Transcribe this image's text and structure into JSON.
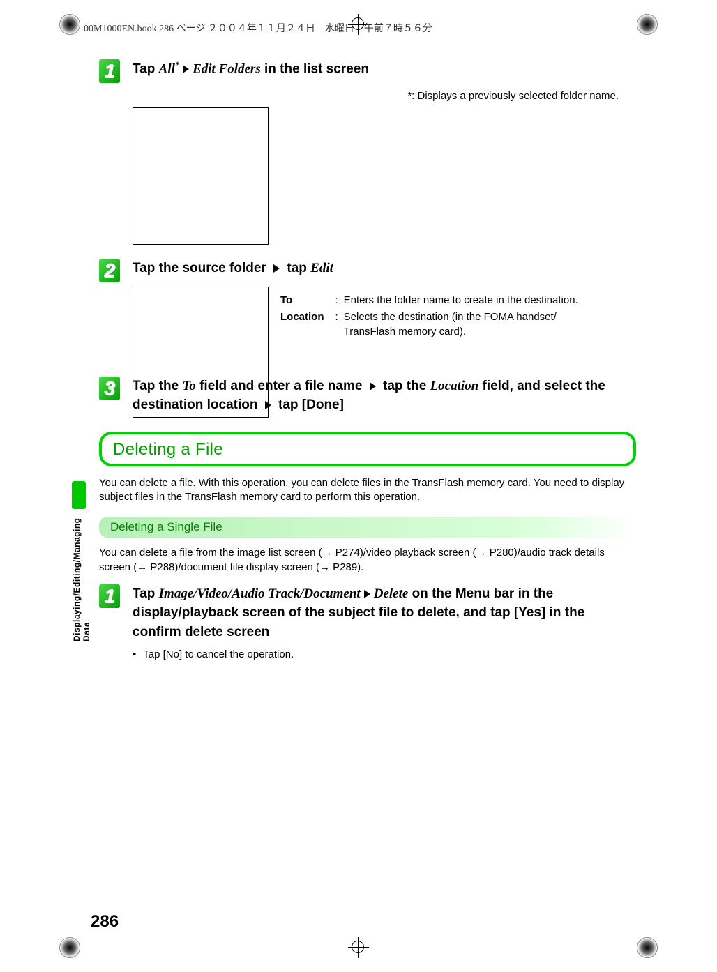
{
  "header": {
    "print_info": "00M1000EN.book  286 ページ  ２００４年１１月２４日　水曜日　午前７時５６分"
  },
  "side_tab": {
    "label": "Displaying/Editing/Managing Data"
  },
  "steps_a": [
    {
      "num": "1",
      "prefix": "Tap ",
      "ital1": "All",
      "sup": "*",
      "mid": " ",
      "ital2": "Edit Folders",
      "suffix": " in the list screen"
    },
    {
      "num": "2",
      "prefix": "Tap the source folder ",
      "ital1": "",
      "mid": " tap ",
      "ital2": "Edit",
      "suffix": ""
    },
    {
      "num": "3",
      "line": "Tap the {i}To{/i} field and enter a file name {t} tap the {i}Location{/i} field, and select the destination location {t} tap [Done]"
    }
  ],
  "footnote": "*: Displays a previously selected folder name.",
  "defs": {
    "to_label": "To",
    "to_desc": "Enters the folder name to create in the destination.",
    "loc_label": "Location",
    "loc_desc1": "Selects the destination (in the FOMA handset/",
    "loc_desc2": "TransFlash memory card)."
  },
  "section": {
    "title": "Deleting a File",
    "intro": "You can delete a file. With this operation, you can delete files in the TransFlash memory card. You need to display subject files in the TransFlash memory card to perform this operation."
  },
  "subsection": {
    "title": "Deleting a Single File",
    "intro": "You can delete a file from the image list screen (→ P274)/video playback screen (→ P280)/audio track details screen (→ P288)/document file display screen (→ P289)."
  },
  "steps_b": [
    {
      "num": "1",
      "prefix": "Tap ",
      "ital1": "Image/Video/Audio Track/Document",
      "mid": " ",
      "ital2": "Delete",
      "suffix": " on the Menu bar in the display/playback screen of the subject file to delete, and tap [Yes] in the confirm delete screen"
    }
  ],
  "bullet": "Tap [No] to cancel the operation.",
  "page_number": "286"
}
